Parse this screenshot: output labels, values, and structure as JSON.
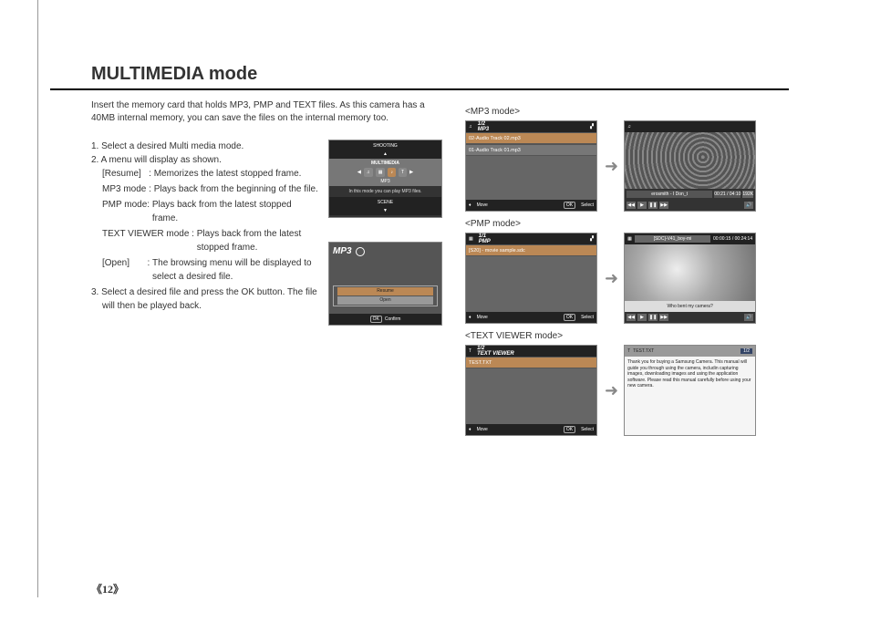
{
  "title": "MULTIMEDIA mode",
  "intro": "Insert the memory card that holds MP3, PMP and TEXT files. As this camera has a 40MB internal memory, you can save the files on the internal memory too.",
  "steps": {
    "s1": "1. Select a desired Multi media mode.",
    "s2": "2. A menu will display as shown.",
    "defs": [
      {
        "label": "[Resume]   : ",
        "text": "Memorizes the latest stopped frame."
      },
      {
        "label": "MP3 mode : ",
        "text": "Plays back from the beginning of the file."
      },
      {
        "label": "PMP mode: ",
        "text": "Plays back from the latest stopped frame."
      },
      {
        "label": "TEXT VIEWER mode : ",
        "text": "Plays back from the latest stopped frame."
      },
      {
        "label": "[Open]       : ",
        "text": "The browsing menu will be displayed to select a desired file."
      }
    ],
    "s3": "3. Select a desired file and press the OK button. The file will then be played back."
  },
  "menu_lcd": {
    "shooting": "SHOOTING",
    "multimedia": "MULTIMEDIA",
    "mp3": "MP3",
    "hint": "In this mode you can play MP3 files.",
    "scene": "SCENE"
  },
  "popup_lcd": {
    "logo": "MP3",
    "resume": "Resume",
    "open": "Open",
    "confirm": "Confirm",
    "ok": "OK"
  },
  "modes": {
    "mp3": {
      "label": "<MP3 mode>",
      "counter": "1/2",
      "title": "MP3",
      "track1": "02-Audio Track 02.mp3",
      "track2": "01-Audio Track 01.mp3",
      "move": "Move",
      "select": "Select",
      "ok": "OK",
      "nowplaying": "erosmith - I Don_t",
      "time": "00:21 / 04:10",
      "kbps": "192K"
    },
    "pmp": {
      "label": "<PMP mode>",
      "counter": "1/1",
      "title": "PMP",
      "file": "[S20] - movie sample.sdc",
      "move": "Move",
      "select": "Select",
      "ok": "OK",
      "nowplaying": "[SDC]-V41_boy-mi",
      "time": "00:00:15 / 00:24:14",
      "caption": "Who bent my camera?"
    },
    "text": {
      "label": "<TEXT VIEWER mode>",
      "counter": "1/2",
      "title": "TEXT VIEWER",
      "file": "TEST.TXT",
      "move": "Move",
      "select": "Select",
      "ok": "OK",
      "play_title": "TEST.TXT",
      "page": "1/2",
      "body": "Thank you for buying a Samsung Camera. This manual will guide you through using the camera, includin capturing images, downloading images and using the application software. Please read this manual carefully before using your new camera."
    }
  },
  "pagenum": "《12》"
}
